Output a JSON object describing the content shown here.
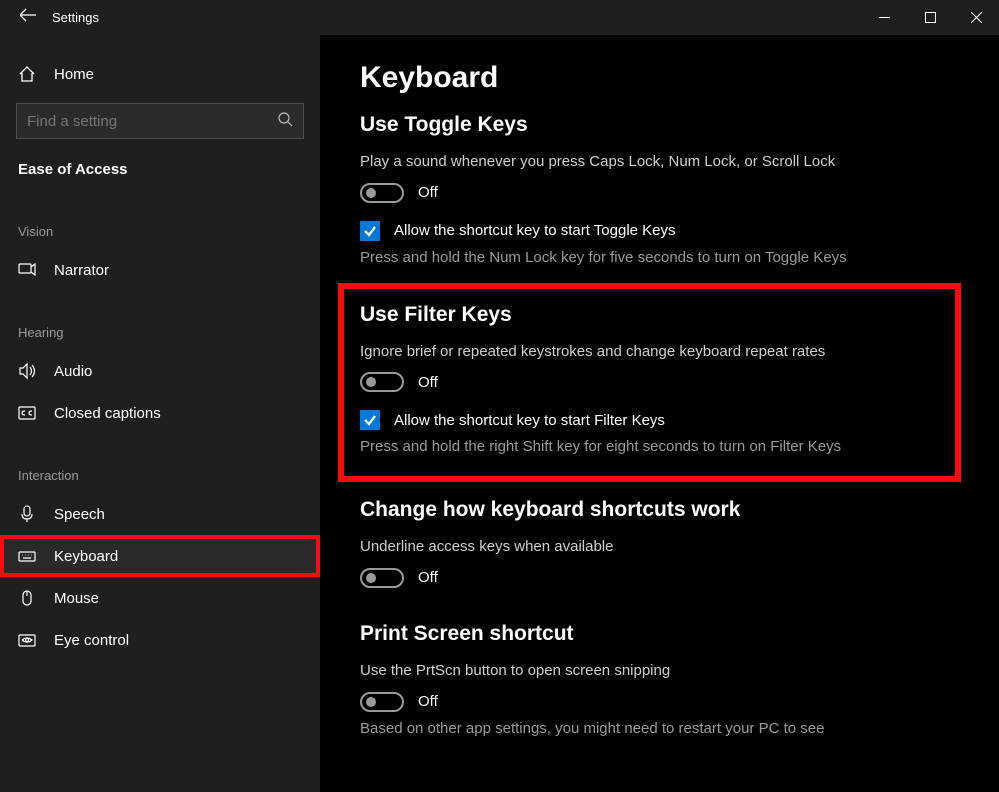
{
  "titlebar": {
    "title": "Settings"
  },
  "sidebar": {
    "home": "Home",
    "search_placeholder": "Find a setting",
    "category": "Ease of Access",
    "groups": [
      {
        "label": "Vision",
        "items": [
          {
            "id": "narrator",
            "label": "Narrator",
            "selected": false
          }
        ]
      },
      {
        "label": "Hearing",
        "items": [
          {
            "id": "audio",
            "label": "Audio",
            "selected": false
          },
          {
            "id": "closed-captions",
            "label": "Closed captions",
            "selected": false
          }
        ]
      },
      {
        "label": "Interaction",
        "items": [
          {
            "id": "speech",
            "label": "Speech",
            "selected": false
          },
          {
            "id": "keyboard",
            "label": "Keyboard",
            "selected": true
          },
          {
            "id": "mouse",
            "label": "Mouse",
            "selected": false
          },
          {
            "id": "eye-control",
            "label": "Eye control",
            "selected": false
          }
        ]
      }
    ]
  },
  "main": {
    "title": "Keyboard",
    "toggle_keys": {
      "heading": "Use Toggle Keys",
      "desc": "Play a sound whenever you press Caps Lock, Num Lock, or Scroll Lock",
      "state": "Off",
      "checkbox_label": "Allow the shortcut key to start Toggle Keys",
      "hint": "Press and hold the Num Lock key for five seconds to turn on Toggle Keys"
    },
    "filter_keys": {
      "heading": "Use Filter Keys",
      "desc": "Ignore brief or repeated keystrokes and change keyboard repeat rates",
      "state": "Off",
      "checkbox_label": "Allow the shortcut key to start Filter Keys",
      "hint": "Press and hold the right Shift key for eight seconds to turn on Filter Keys"
    },
    "shortcuts": {
      "heading": "Change how keyboard shortcuts work",
      "desc": "Underline access keys when available",
      "state": "Off"
    },
    "printscreen": {
      "heading": "Print Screen shortcut",
      "desc": "Use the PrtScn button to open screen snipping",
      "state": "Off",
      "hint": "Based on other app settings, you might need to restart your PC to see"
    }
  }
}
